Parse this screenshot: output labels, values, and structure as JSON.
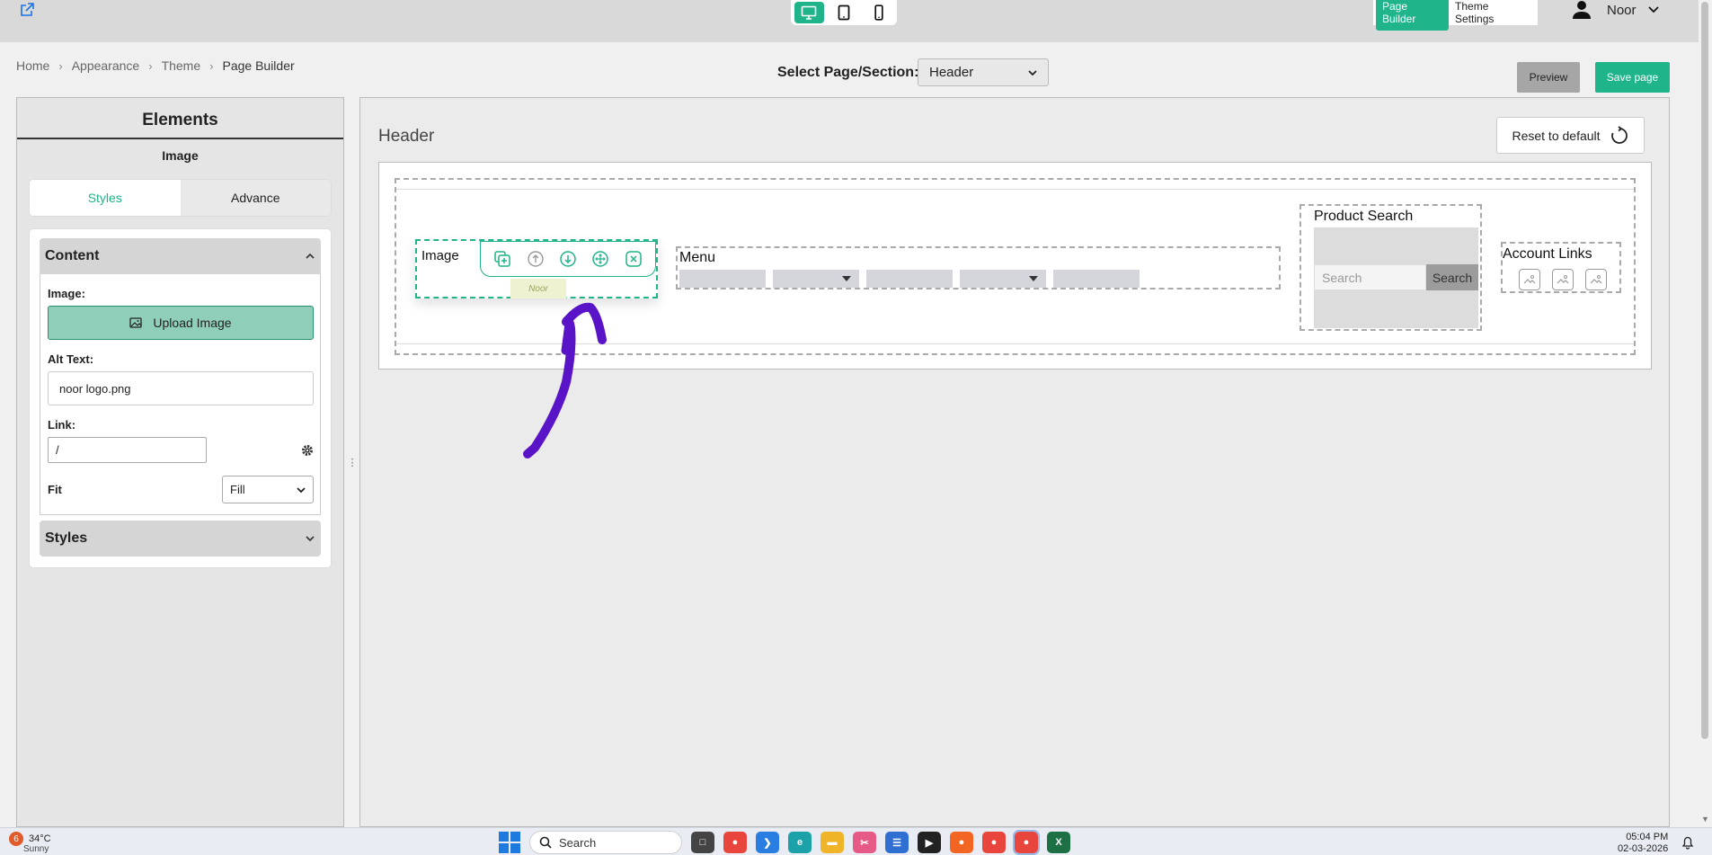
{
  "topbar": {
    "devices": [
      "desktop",
      "tablet",
      "mobile"
    ],
    "active_device": "desktop",
    "modes": [
      "Page Builder",
      "Theme Settings"
    ],
    "active_mode": "Page Builder",
    "user_name": "Noor"
  },
  "breadcrumb": [
    "Home",
    "Appearance",
    "Theme",
    "Page Builder"
  ],
  "page_select": {
    "label": "Select Page/Section:",
    "value": "Header"
  },
  "actions": {
    "preview": "Preview",
    "save": "Save page"
  },
  "sidebar": {
    "title": "Elements",
    "selected_element": "Image",
    "tabs": [
      "Styles",
      "Advance"
    ],
    "active_tab": "Styles",
    "content_section": {
      "title": "Content",
      "image_label": "Image:",
      "upload_label": "Upload Image",
      "alt_label": "Alt Text:",
      "alt_value": "noor logo.png",
      "link_label": "Link:",
      "link_value": "/",
      "fit_label": "Fit",
      "fit_value": "Fill"
    },
    "styles_section": {
      "title": "Styles"
    }
  },
  "canvas": {
    "title": "Header",
    "reset_label": "Reset to default",
    "image_block": {
      "label": "Image",
      "logo_text": "Noor"
    },
    "menu_block": {
      "label": "Menu",
      "items": [
        {
          "dropdown": false
        },
        {
          "dropdown": true
        },
        {
          "dropdown": false
        },
        {
          "dropdown": true
        },
        {
          "dropdown": false
        }
      ]
    },
    "search_block": {
      "label": "Product Search",
      "placeholder": "Search",
      "button": "Search"
    },
    "account_block": {
      "label": "Account Links"
    }
  },
  "colors": {
    "accent": "#1fb48a",
    "annotation": "#5a14c8"
  },
  "taskbar": {
    "weather_count": "6",
    "temperature": "34°C",
    "condition": "Sunny",
    "search_label": "Search",
    "time": "05:04 PM",
    "date": "02-03-2026"
  }
}
